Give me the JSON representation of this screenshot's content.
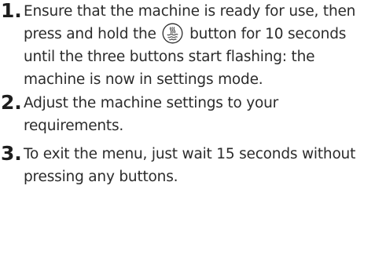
{
  "steps": [
    {
      "number": "1.",
      "text_before_icon": "Ensure that the machine is ready for use, then press and hold the",
      "icon": "steam-button-icon",
      "text_after_icon": "button for 10 seconds until the three buttons start flashing: the machine is now in settings mode."
    },
    {
      "number": "2.",
      "text": "Adjust the machine settings to your requirements."
    },
    {
      "number": "3.",
      "text": "To exit the menu, just wait 15 seconds without pressing any buttons."
    }
  ]
}
